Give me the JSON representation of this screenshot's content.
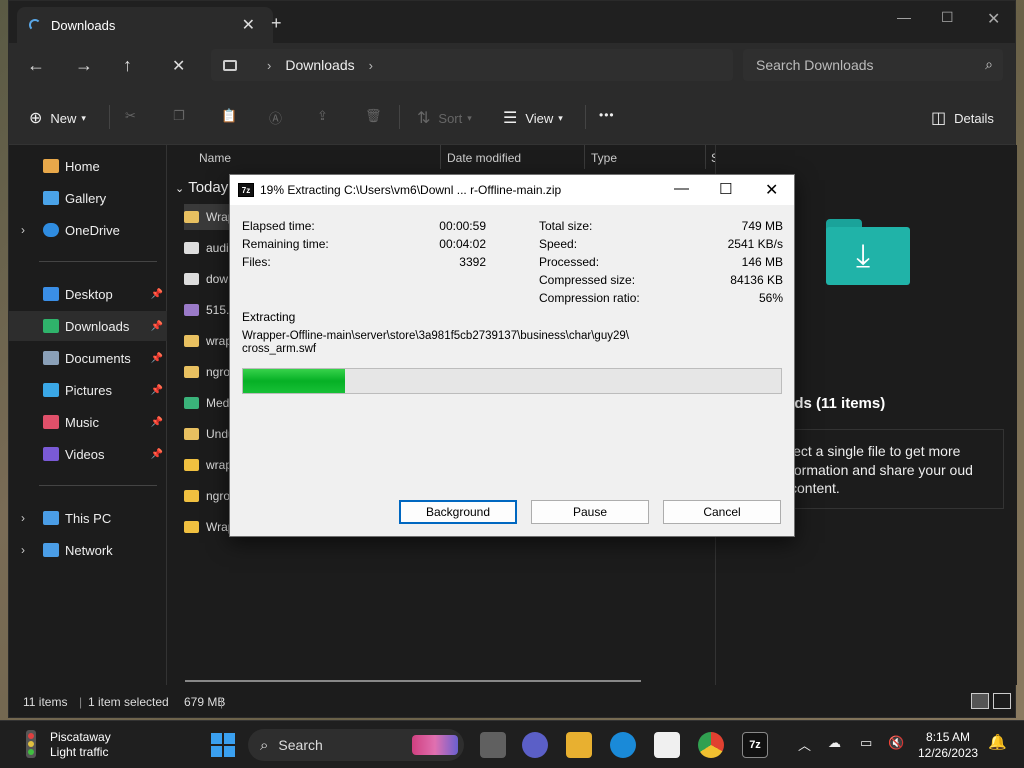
{
  "explorer": {
    "tab_title": "Downloads",
    "breadcrumb": [
      "Downloads"
    ],
    "search_placeholder": "Search Downloads",
    "toolbar": {
      "new_label": "New",
      "sort_label": "Sort",
      "view_label": "View",
      "details_label": "Details",
      "more": "•••"
    },
    "sidebar": {
      "top": [
        {
          "label": "Home",
          "color": "#e8a84a"
        },
        {
          "label": "Gallery",
          "color": "#4aa3e8"
        },
        {
          "label": "OneDrive",
          "color": "#2f8ce0"
        }
      ],
      "pinned": [
        {
          "label": "Desktop",
          "color": "#3a8ee6"
        },
        {
          "label": "Downloads",
          "color": "#2fb36b"
        },
        {
          "label": "Documents",
          "color": "#8aa0b8"
        },
        {
          "label": "Pictures",
          "color": "#3aa7e6"
        },
        {
          "label": "Music",
          "color": "#e0506a"
        },
        {
          "label": "Videos",
          "color": "#7a5ad6"
        }
      ],
      "bottom": [
        {
          "label": "This PC",
          "color": "#4a9de6"
        },
        {
          "label": "Network",
          "color": "#4a9de6"
        }
      ]
    },
    "columns": [
      "Name",
      "Date modified",
      "Type",
      "S"
    ],
    "group_label": "Today",
    "files": [
      {
        "name": "Wrap",
        "color": "#e8c060"
      },
      {
        "name": "audi",
        "color": "#dddddd"
      },
      {
        "name": "dow",
        "color": "#dddddd"
      },
      {
        "name": "515.",
        "color": "#9a7ac8"
      },
      {
        "name": "wrap",
        "color": "#e8c060"
      },
      {
        "name": "ngro",
        "color": "#e8c060"
      },
      {
        "name": "Med",
        "color": "#3ab37a"
      },
      {
        "name": "Undu",
        "color": "#e8c060"
      },
      {
        "name": "wrap",
        "color": "#f0c040"
      },
      {
        "name": "ngro",
        "color": "#f0c040"
      },
      {
        "name": "Wrap",
        "color": "#f0c040"
      }
    ],
    "details_pane": {
      "title": "ads (11 items)",
      "hint": "lect a single file to get more formation and share your oud content."
    },
    "status": {
      "items": "11 items",
      "selected": "1 item selected",
      "size": "679 MB"
    }
  },
  "dialog": {
    "title": "19% Extracting C:\\Users\\vm6\\Downl ... r-Offline-main.zip",
    "icon_text": "7z",
    "left_stats": [
      {
        "label": "Elapsed time:",
        "value": "00:00:59"
      },
      {
        "label": "Remaining time:",
        "value": "00:04:02"
      },
      {
        "label": "Files:",
        "value": "3392"
      }
    ],
    "right_stats": [
      {
        "label": "Total size:",
        "value": "749 MB"
      },
      {
        "label": "Speed:",
        "value": "2541 KB/s"
      },
      {
        "label": "Processed:",
        "value": "146 MB"
      },
      {
        "label": "Compressed size:",
        "value": "84136 KB"
      },
      {
        "label": "Compression ratio:",
        "value": "56%"
      }
    ],
    "action_label": "Extracting",
    "current_file_line1": "Wrapper-Offline-main\\server\\store\\3a981f5cb2739137\\business\\char\\guy29\\",
    "current_file_line2": "cross_arm.swf",
    "progress": 0.19,
    "buttons": {
      "background": "Background",
      "pause": "Pause",
      "cancel": "Cancel"
    }
  },
  "taskbar": {
    "weather_city": "Piscataway",
    "weather_status": "Light traffic",
    "search_label": "Search",
    "time": "8:15 AM",
    "date": "12/26/2023"
  }
}
